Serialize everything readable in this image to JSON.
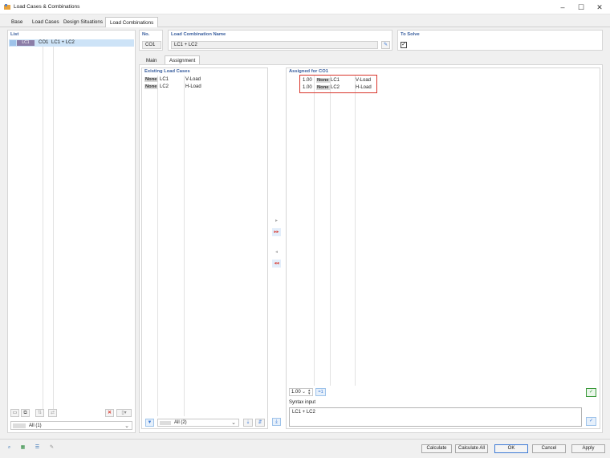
{
  "window": {
    "title": "Load Cases & Combinations",
    "icons": [
      "app-icon",
      "minimize-icon",
      "maximize-icon",
      "close-icon"
    ]
  },
  "tabs": [
    {
      "label": "Base"
    },
    {
      "label": "Load Cases"
    },
    {
      "label": "Design Situations"
    },
    {
      "label": "Load Combinations",
      "active": true
    }
  ],
  "list": {
    "header": "List",
    "item": {
      "badge": "LC1",
      "id": "CO1",
      "name": "LC1 + LC2"
    },
    "filter_value": "All (1)"
  },
  "form": {
    "no_label": "No.",
    "no_value": "CO1",
    "name_label": "Load Combination Name",
    "name_value": "LC1 + LC2",
    "to_solve_label": "To Solve",
    "to_solve_checked": true
  },
  "subtabs": [
    {
      "label": "Main"
    },
    {
      "label": "Assignment",
      "active": true
    }
  ],
  "existing": {
    "header": "Existing Load Cases",
    "rows": [
      {
        "tag": "None",
        "id": "LC1",
        "name": "V-Load"
      },
      {
        "tag": "None",
        "id": "LC2",
        "name": "H-Load"
      }
    ],
    "filter_value": "All (2)"
  },
  "assigned": {
    "header": "Assigned for CO1",
    "rows": [
      {
        "factor": "1.00",
        "tag": "None",
        "id": "LC1",
        "name": "V-Load"
      },
      {
        "factor": "1.00",
        "tag": "None",
        "id": "LC2",
        "name": "H-Load"
      }
    ],
    "factor_value": "1.00",
    "factor_button": "=1",
    "syntax_label": "Syntax input",
    "syntax_value": "LC1 + LC2"
  },
  "transfer": {
    "add_one": "▸",
    "add_all": "▸▸",
    "remove_one": "◂",
    "remove_all": "◂◂"
  },
  "footer": {
    "calculate": "Calculate",
    "calculate_all": "Calculate All",
    "ok": "OK",
    "cancel": "Cancel",
    "apply": "Apply"
  },
  "colors": {
    "accent_blue": "#3a5f9e",
    "highlight_red": "#d9362c",
    "selection": "#cde3f7"
  }
}
